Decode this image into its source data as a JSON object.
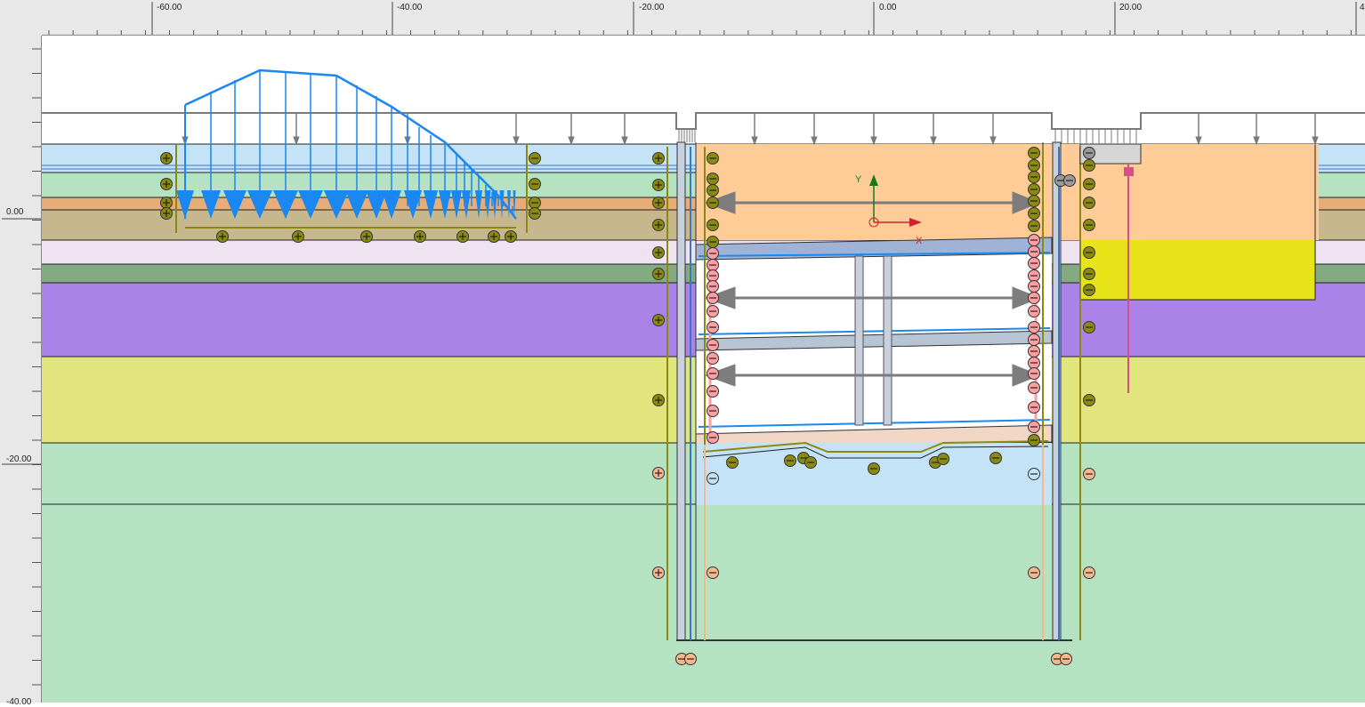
{
  "ruler": {
    "x_labels": [
      "-60.00",
      "-40.00",
      "-20.00",
      "0.00",
      "20.00",
      "4"
    ],
    "y_labels": [
      "0.00",
      "-20.00",
      "-40.00"
    ]
  },
  "axes": {
    "y_label": "Y",
    "x_label": "X"
  },
  "colors": {
    "layer_light_blue": "#c5e3f6",
    "layer_mint": "#b5e2c0",
    "layer_orange": "#e6ad78",
    "layer_tan": "#c6b78d",
    "layer_lavender": "#efe3f1",
    "layer_darkgreen": "#84aa82",
    "layer_purple": "#ab83e8",
    "layer_yellow": "#e2e47e",
    "excavation_orange": "#ffcb96",
    "bright_yellow": "#e6e419",
    "load_blue": "#1a88f0",
    "olive": "#8a8a10",
    "pink_anchor": "#ff9fa2",
    "salmon": "#f4b78e",
    "wall_grey": "#c7d0dc",
    "anchor_pink": "#d64f86"
  },
  "icons": {
    "positive_interface": "plus-circle-icon",
    "negative_interface": "minus-circle-icon",
    "fixed_end_anchor": "double-arrow-anchor-icon",
    "origin": "origin-crosshair-icon"
  }
}
